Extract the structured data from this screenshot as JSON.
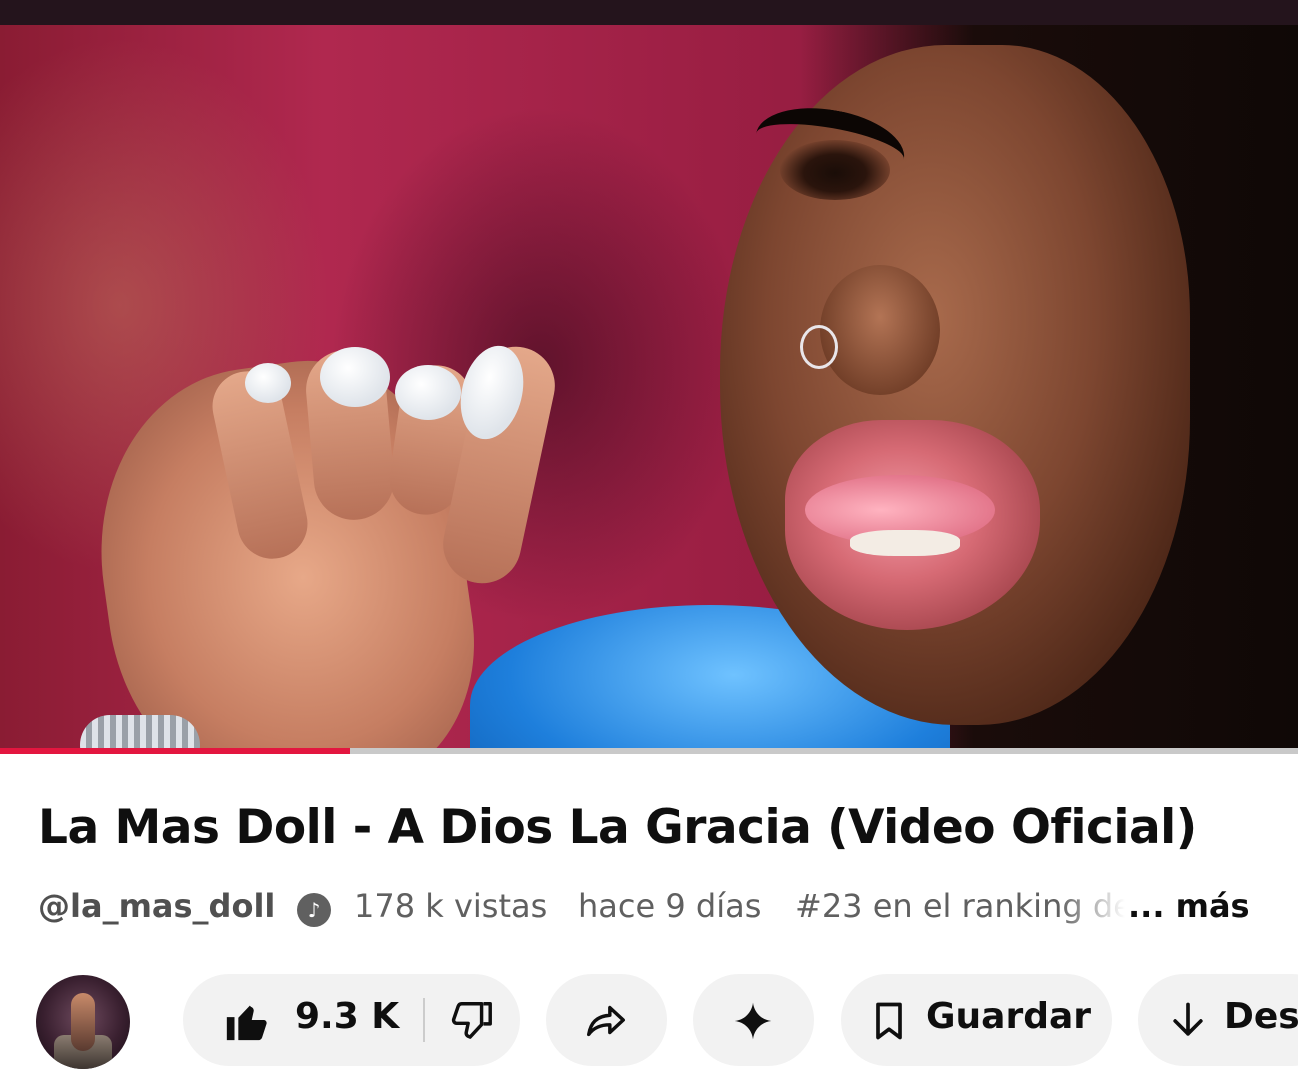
{
  "video": {
    "title": "La Mas Doll - A Dios La Gracia (Video Oficial)",
    "progress_fraction": 0.27
  },
  "meta": {
    "channel_handle": "@la_mas_doll",
    "verified_icon": "music-note-verified-icon",
    "views": "178 k vistas",
    "published": "hace 9 días",
    "ranking": "#23 en el ranking de",
    "more_label": "... más"
  },
  "actions": {
    "like_count": "9.3 K",
    "like_icon": "thumbs-up-icon",
    "dislike_icon": "thumbs-down-icon",
    "share_icon": "share-arrow-icon",
    "remix_icon": "sparkle-icon",
    "save_label": "Guardar",
    "save_icon": "bookmark-icon",
    "download_label": "Descargar",
    "download_icon": "download-arrow-icon"
  },
  "colors": {
    "progress_played": "#e3163f",
    "progress_track": "#c9c9c9",
    "pill_background": "#f2f2f2",
    "title_text": "#0f0f0f",
    "meta_text": "#606060"
  }
}
